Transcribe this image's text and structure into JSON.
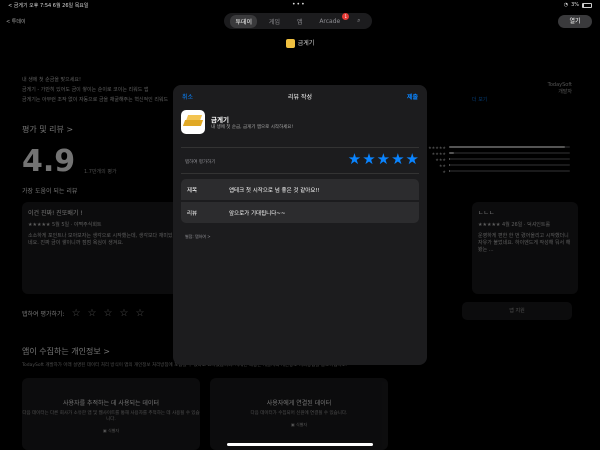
{
  "status": {
    "left": "< 금게기  오후 7:54  6월 26일 목요일",
    "battery": "3%"
  },
  "top": {
    "back": "< 투데이",
    "tabs": [
      {
        "label": "투데이",
        "active": true
      },
      {
        "label": "게임"
      },
      {
        "label": "앱"
      },
      {
        "label": "Arcade",
        "badge": "1"
      }
    ],
    "open_button": "열기",
    "app_title": "금게기"
  },
  "background": {
    "desc1": "내 생에 첫 순금을 맞으세요!",
    "desc2": "금게기 - 가만히 있어도 금이 쌓이는 순이로 코이는 리워드 앱",
    "desc3": "금게기는 아무런 조작 없이 자동으로 금을 채굴해주는 혁신적인 리워드",
    "desc_more": "더 보기",
    "dev_name": "TodaySoft",
    "dev_role": "개발자",
    "ratings_title": "평가 및 리뷰 >",
    "score": "4.9",
    "score_sub": "1.7만개의 평가",
    "helpful": "가장 도움이 되는 리뷰",
    "card1_title": "이건 진짜! 진또배기 !",
    "card1_meta": "★★★★★  5월 5일 · 야쩍주식회트",
    "card1_body": "소소하게 포인트나 모아보자는 생각으로 시작했는데, 생각보다 재미있네요. 진짜 금이 쌓이니까 점점 욕심이 생겨요.",
    "card2_title": "ㄴㄴㄴ",
    "card2_meta": "★★★★★  4월 26일 · 덕셔인트롤",
    "card2_body": "운영하게 편한 한 번 렸어올리고 시작했더니 자유가 불었네요. 하이엔드게 작성해 둬서 해봤는 ...",
    "tap_rate": "탭하여 평가하기:",
    "support": "앱 지원",
    "privacy_title": "앱이 수집하는 개인정보 >",
    "privacy_desc": "TodaySoft 개발자가 아래 설명된 데이터 처리 방식이 앱의 개인정보 처리방침에 포함될 수 있다고 표시했습니다. 자세한 내용은 개발자의 개인정보 처리방침을 참조하십시오.",
    "pcard1_title": "사용자를 추적하는 데 사용되는 데이터",
    "pcard1_body": "다음 데이터는 다른 회사가 소유한 앱 및 웹사이트를 통해 사용자를 추적하는 데 사용될 수 있습니다.",
    "pcard1_chip": "식별자",
    "pcard2_title": "사용자에게 연결된 데이터",
    "pcard2_body": "다음 데이터가 수집되어 신원에 연결될 수 있습니다.",
    "pcard2_chip": "식별자"
  },
  "sheet": {
    "cancel": "취소",
    "title": "리뷰 작성",
    "submit": "제출",
    "app_name": "금게기",
    "app_sub": "내 생에 첫 순금, 금게기 앱으로 시작하세요!",
    "tap_label": "탭하여 평가하기",
    "rating": 5,
    "title_label": "제목",
    "title_value": "앱테크 첫 시작으로 넘 좋은 것 같아요!!",
    "review_label": "리뷰",
    "review_value": "앞으로가 기대됩니다~~",
    "hint": "별점: 탭하여 >"
  },
  "colors": {
    "accent": "#0a84ff",
    "badge": "#e53935"
  }
}
